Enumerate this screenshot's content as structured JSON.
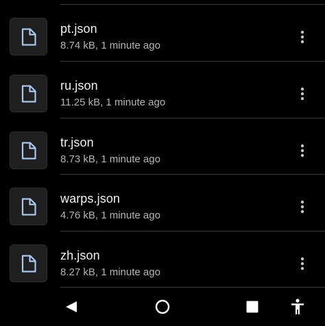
{
  "files": [
    {
      "name": "pt.json",
      "meta": "8.74 kB, 1 minute ago",
      "icon": "document-icon"
    },
    {
      "name": "ru.json",
      "meta": "11.25 kB, 1 minute ago",
      "icon": "document-icon"
    },
    {
      "name": "tr.json",
      "meta": "8.73 kB, 1 minute ago",
      "icon": "document-icon"
    },
    {
      "name": "warps.json",
      "meta": "4.76 kB, 1 minute ago",
      "icon": "document-icon"
    },
    {
      "name": "zh.json",
      "meta": "8.27 kB, 1 minute ago",
      "icon": "document-icon"
    }
  ],
  "navbar": {
    "back": "back-icon",
    "home": "home-icon",
    "recents": "recents-icon",
    "accessibility": "accessibility-icon"
  },
  "colors": {
    "background": "#000000",
    "thumb_bg": "#1f1f1f",
    "doc_icon": "#a8c8f0",
    "text_primary": "#f1f1f1",
    "text_secondary": "#b5b5b5",
    "divider": "#3c3c3c"
  }
}
